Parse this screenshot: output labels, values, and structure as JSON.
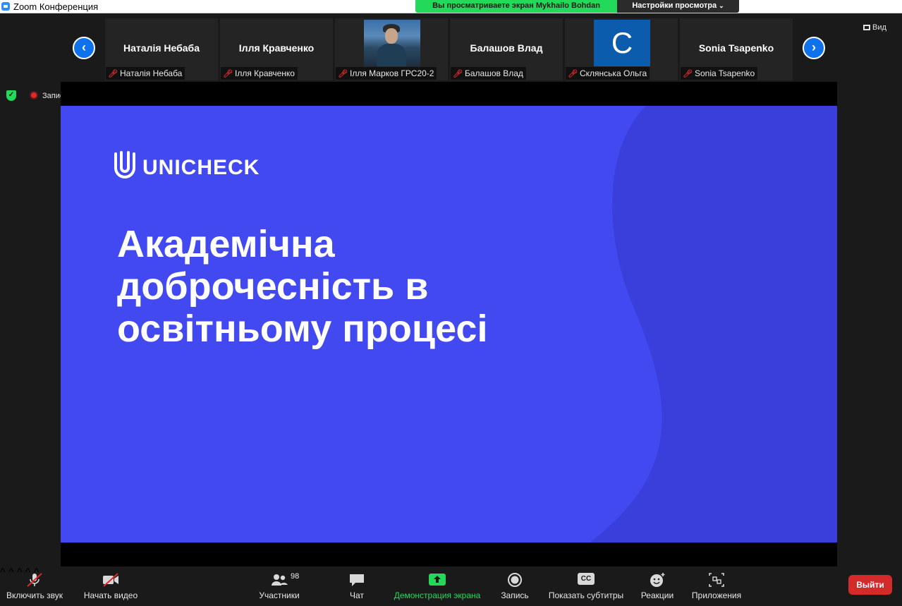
{
  "window": {
    "title": "Zoom Конференция"
  },
  "share_banner": {
    "text": "Вы просматриваете экран Mykhailo Bohdan"
  },
  "view_settings": {
    "label": "Настройки просмотра"
  },
  "view_button": {
    "label": "Вид"
  },
  "gallery": {
    "tiles": [
      {
        "name": "Наталія Небаба",
        "label": "Наталія Небаба",
        "kind": "name"
      },
      {
        "name": "Ілля Кравченко",
        "label": "Ілля Кравченко",
        "kind": "name"
      },
      {
        "name": "",
        "label": "Ілля Марков ГРС20-2",
        "kind": "photo"
      },
      {
        "name": "Балашов Влад",
        "label": "Балашов Влад",
        "kind": "name"
      },
      {
        "name": "C",
        "label": "Склянська Ольга",
        "kind": "avatar"
      },
      {
        "name": "Sonia Tsapenko",
        "label": "Sonia Tsapenko",
        "kind": "name"
      }
    ]
  },
  "status": {
    "recording_label": "Запись"
  },
  "slide": {
    "brand": "UNICHECK",
    "title_lines": [
      "Академічна",
      "доброчесність в",
      "освітньому процесі"
    ],
    "colors": {
      "background": "#4349f0",
      "wave": "#3a3fdc"
    }
  },
  "toolbar": {
    "unmute": "Включить звук",
    "start_video": "Начать видео",
    "participants": "Участники",
    "participants_count": "98",
    "chat": "Чат",
    "share": "Демонстрация экрана",
    "record": "Запись",
    "captions": "Показать субтитры",
    "captions_badge": "CC",
    "reactions": "Реакции",
    "apps": "Приложения",
    "leave": "Выйти"
  }
}
